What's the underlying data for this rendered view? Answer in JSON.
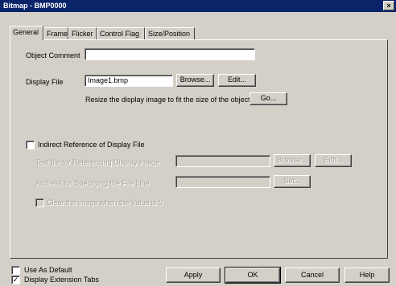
{
  "window": {
    "title": "Bitmap - BMP0000",
    "close_glyph": "×"
  },
  "tabs": [
    "General",
    "Frame",
    "Flicker",
    "Control Flag",
    "Size/Position"
  ],
  "general": {
    "object_comment_label": "Object Comment",
    "object_comment_value": "",
    "display_file_label": "Display File",
    "display_file_value": "Image1.bmp",
    "browse_label": "Browse...",
    "edit_label": "Edit...",
    "resize_text": "Resize the display image to fit the size of the object.",
    "go_label": "Go...",
    "indirect_ref_label": "Indirect Reference of Display File",
    "indirect_ref_checked": false,
    "text_file_label": "Text file for Referencing Display Image",
    "browse_disabled_label": "Browse...",
    "edit_disabled_label": "Edit...",
    "address_label": "Address for Specifying the File Line",
    "set_label": "Set...",
    "clear_image_label": "Clear the image when the Value is 0"
  },
  "footer": {
    "use_as_default_label": "Use As Default",
    "use_as_default_checked": false,
    "display_ext_tabs_label": "Display Extension Tabs",
    "display_ext_tabs_checked": true,
    "apply_label": "Apply",
    "ok_label": "OK",
    "cancel_label": "Cancel",
    "help_label": "Help"
  }
}
